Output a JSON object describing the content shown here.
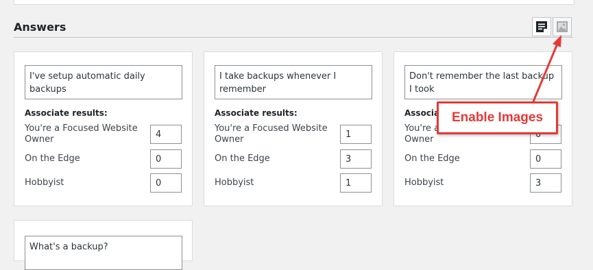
{
  "section": {
    "title": "Answers"
  },
  "toolbar": {
    "text_mode_icon": "text-answers-icon",
    "image_mode_icon": "image-answers-icon"
  },
  "callout": {
    "text": "Enable Images",
    "color": "#e53935"
  },
  "labels": {
    "associate": "Associate results:"
  },
  "cards": [
    {
      "answer": "I've setup automatic daily backups",
      "results": [
        {
          "label": "You're a Focused Website Owner",
          "value": "4"
        },
        {
          "label": "On the Edge",
          "value": "0"
        },
        {
          "label": "Hobbyist",
          "value": "0"
        }
      ]
    },
    {
      "answer": "I take backups whenever I remember",
      "results": [
        {
          "label": "You're a Focused Website Owner",
          "value": "1"
        },
        {
          "label": "On the Edge",
          "value": "3"
        },
        {
          "label": "Hobbyist",
          "value": "1"
        }
      ]
    },
    {
      "answer": "Don't remember the last backup I took",
      "results": [
        {
          "label": "You're a Focused Website Owner",
          "value": "0"
        },
        {
          "label": "On the Edge",
          "value": "0"
        },
        {
          "label": "Hobbyist",
          "value": "3"
        }
      ]
    },
    {
      "answer": "What's a backup?",
      "results": []
    }
  ]
}
